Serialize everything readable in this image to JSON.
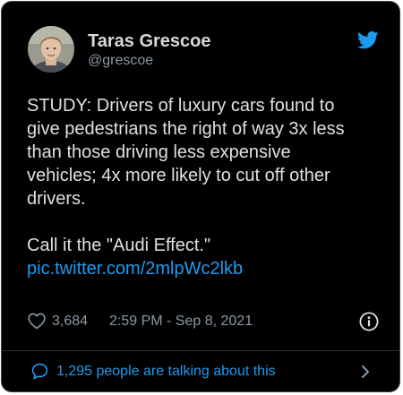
{
  "author": {
    "name": "Taras Grescoe",
    "handle": "@grescoe"
  },
  "icons": {
    "brand": "twitter-bird-icon",
    "like": "heart-icon",
    "info": "info-icon",
    "reply": "chat-bubble-icon",
    "more": "chevron-right-icon"
  },
  "tweet": {
    "text_lines": [
      "STUDY: Drivers of luxury cars found to",
      "give pedestrians the right of way 3x less",
      "than those driving less expensive",
      "vehicles; 4x more likely to cut off other",
      "drivers."
    ],
    "closing_line": "Call it the \"Audi Effect.\"",
    "pic_link": "pic.twitter.com/2mlpWc2lkb"
  },
  "meta": {
    "like_count": "3,684",
    "timestamp": "2:59 PM - Sep 8, 2021"
  },
  "footer": {
    "talking_text": "1,295 people are talking about this"
  },
  "colors": {
    "background": "#000000",
    "text": "#d9d9d9",
    "secondary_text": "#8b98a5",
    "accent": "#1d9bf0",
    "border": "#3d4247"
  }
}
